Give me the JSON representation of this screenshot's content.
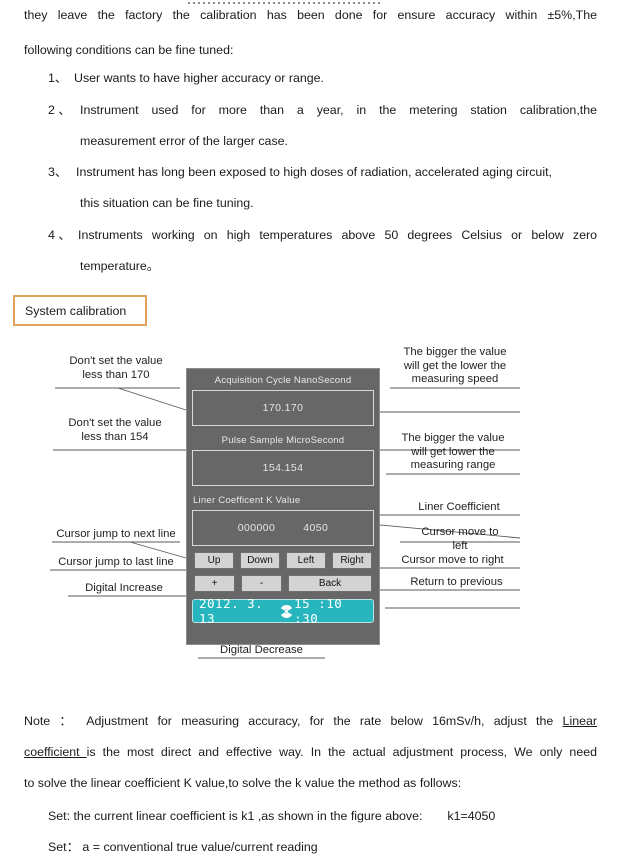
{
  "document": {
    "intro": {
      "line1": "they leave the factory the calibration has been done for ensure accuracy within ±5%,The",
      "line2": "following conditions can be fine tuned:"
    },
    "numbered_items": [
      {
        "marker": "1、",
        "lines": [
          "User wants to have higher accuracy or range."
        ]
      },
      {
        "marker": "2 、",
        "lines": [
          "Instrument used for more than a year, in the metering station calibration,the",
          "measurement error of the larger case."
        ]
      },
      {
        "marker": "3、",
        "lines": [
          "Instrument has long been exposed to high doses of radiation, accelerated aging circuit,",
          "this situation can be fine tuning."
        ]
      },
      {
        "marker": "4 、",
        "lines": [
          "Instruments working on high temperatures above 50 degrees Celsius or below zero",
          "temperature。"
        ]
      }
    ],
    "section_callout": "System calibration",
    "note": {
      "line1_a": "Note ： Adjustment for measuring accuracy, for the rate below 16mSv/h, adjust the ",
      "line1_underlined": "Linear",
      "line2_underlined": "coefficient ",
      "line2_b": "is the most direct and effective way. In the actual adjustment process, We only need",
      "line3": "to solve the linear coefficient K value,to solve the k value the method as follows:",
      "line4": "Set: the current linear coefficient is k1 ,as shown in the figure above:",
      "line4_value": "k1=4050",
      "line5": "Set： a = conventional true value/current reading"
    }
  },
  "figure": {
    "device": {
      "field1_label": "Acquisition Cycle NanoSecond",
      "field1_value": "170.170",
      "field2_label": "Pulse Sample MicroSecond",
      "field2_value": "154.154",
      "field3_label": "Liner Coefficent K Value",
      "field3_value_left": "000000",
      "field3_value_right": "4050",
      "buttons_row1": [
        "Up",
        "Down",
        "Left",
        "Right"
      ],
      "buttons_row2": [
        "+",
        "-",
        "Back"
      ],
      "status": {
        "date": "2012. 3. 13",
        "time": "15 :10 :30",
        "icon": "radiation-icon"
      },
      "screen_color": "#676767",
      "status_color": "#27b6bd"
    },
    "annotations_left": [
      "Don't set the value\nless than 170",
      "Don't set the value\nless than 154",
      "Cursor jump to next line",
      "Cursor jump to last line",
      "Digital Increase"
    ],
    "annotations_right": [
      "The bigger the value\nwill get the lower the\nmeasuring speed",
      "The bigger the value\nwill get lower the\nmeasuring range",
      "Liner Coefficient",
      "Cursor move to\nleft",
      "Cursor move to right",
      "Return to previous"
    ],
    "annotation_bottom": "Digital Decrease",
    "left_1_l1": "Don't set the value",
    "left_1_l2": "less than 170",
    "left_2_l1": "Don't set the value",
    "left_2_l2": "less than 154",
    "left_3": "Cursor jump to next line",
    "left_4": "Cursor jump to last line",
    "left_5": "Digital Increase",
    "right_1_l1": "The bigger the value",
    "right_1_l2": "will get the lower the",
    "right_1_l3": "measuring speed",
    "right_2_l1": "The bigger the value",
    "right_2_l2": "will get lower the",
    "right_2_l3": "measuring range",
    "right_3": "Liner Coefficient",
    "right_4_l1": "Cursor move to",
    "right_4_l2": "left",
    "right_5": "Cursor move to right",
    "right_6": "Return to previous",
    "bottom_1": "Digital Decrease"
  },
  "colors": {
    "callout_border": "#e2a05a",
    "device_bg": "#676767",
    "status_bg": "#27b6bd",
    "button_bg": "#d3d3d3"
  }
}
